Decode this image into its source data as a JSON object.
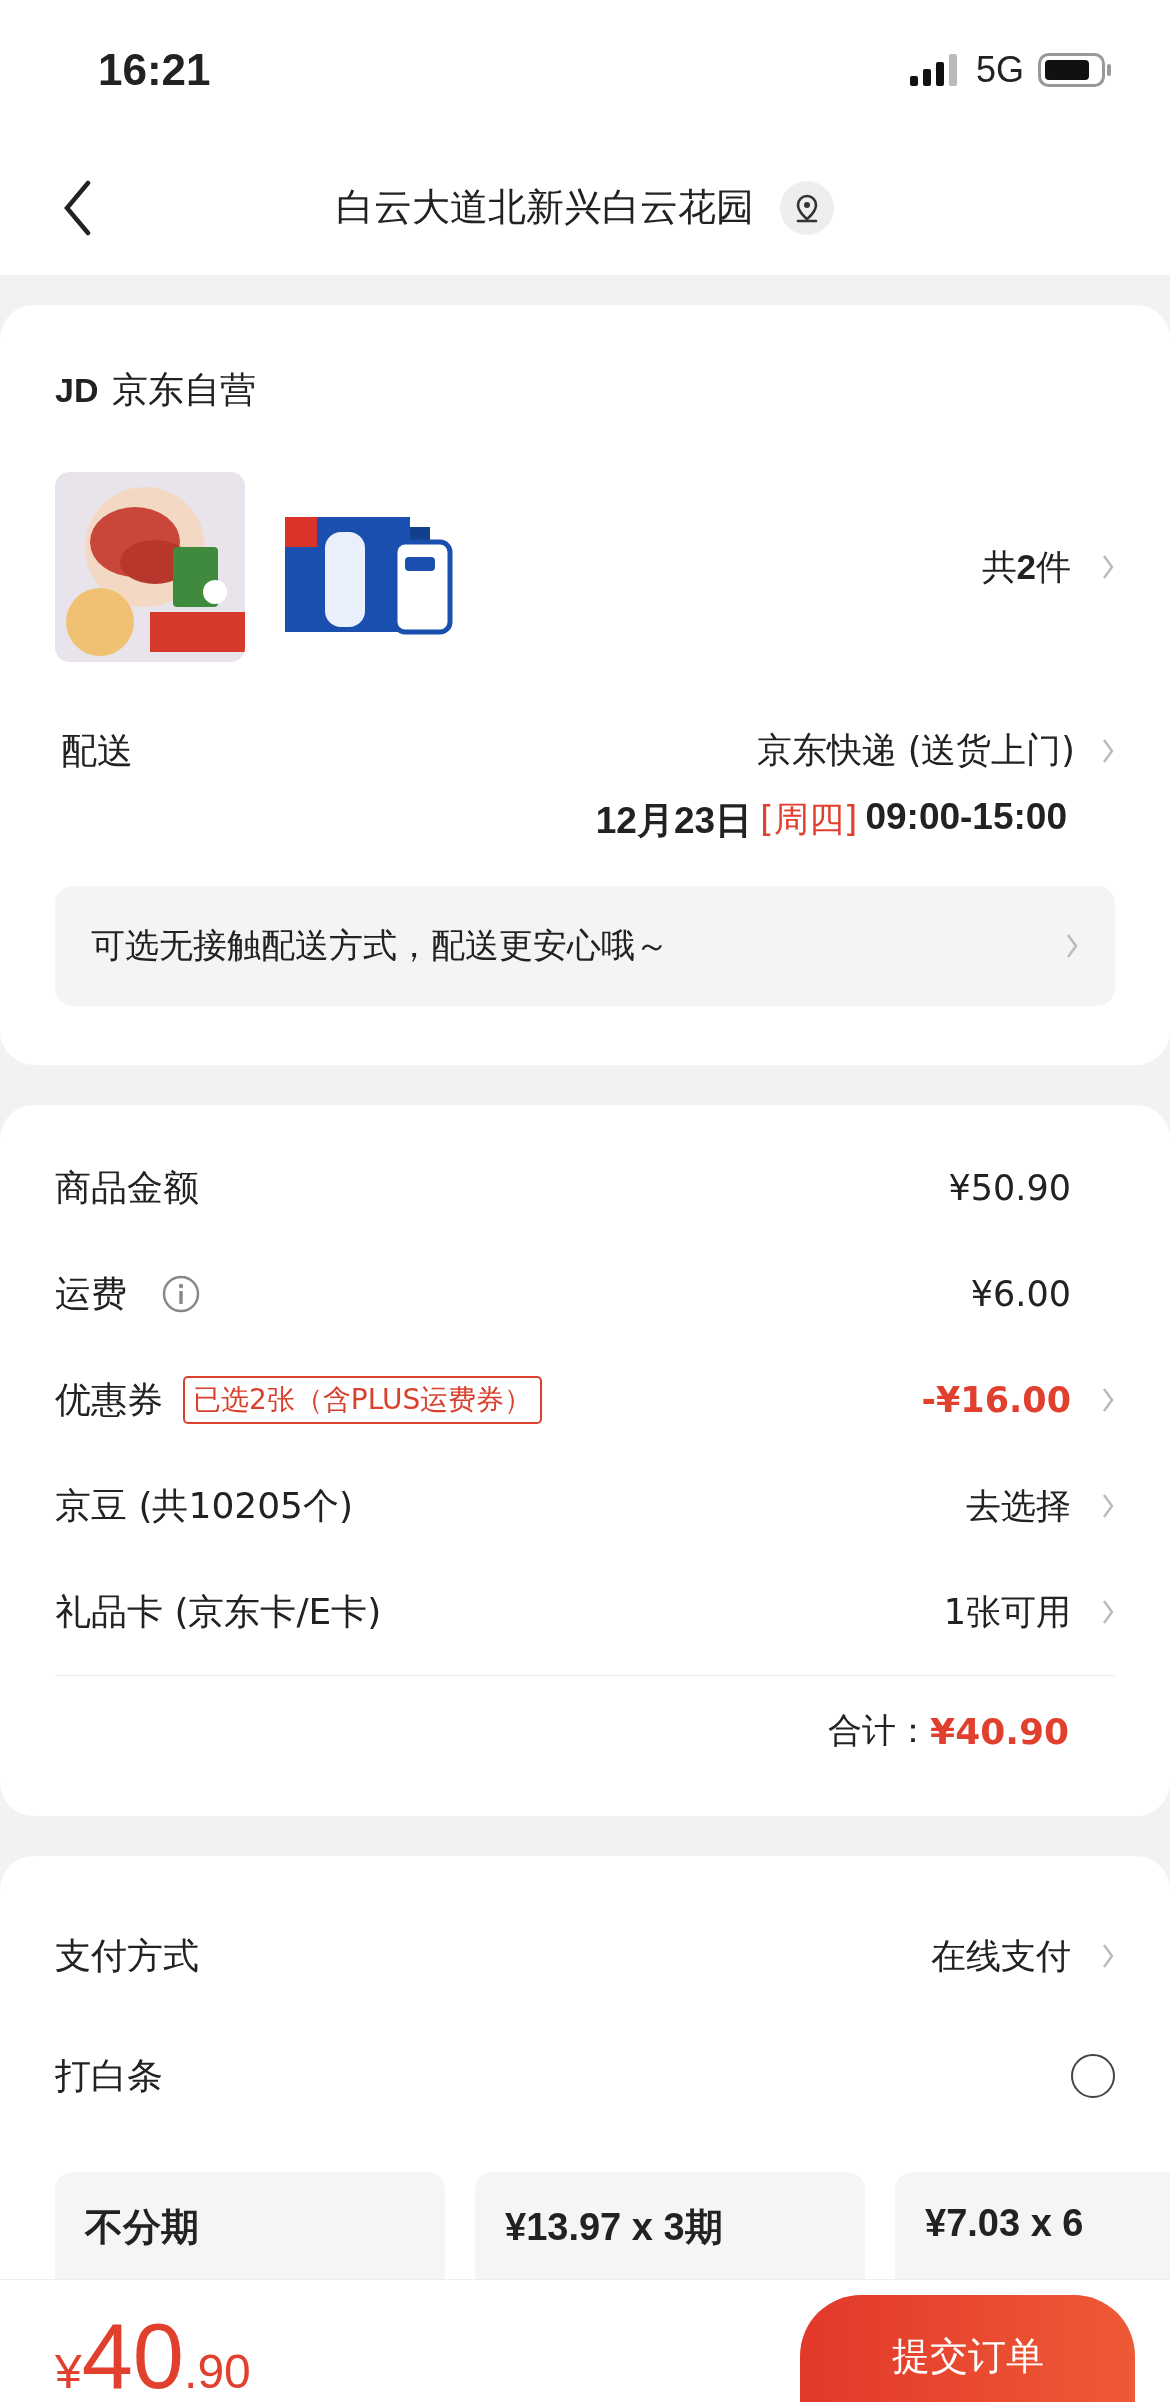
{
  "status_bar": {
    "time": "16:21",
    "network": "5G"
  },
  "header": {
    "title": "白云大道北新兴白云花园"
  },
  "store": {
    "logo": "JD",
    "name": "京东自营",
    "count_prefix": "共",
    "count": "2",
    "count_suffix": "件"
  },
  "delivery": {
    "label": "配送",
    "method": "京东快递 (送货上门)",
    "date": "12月23日",
    "weekday": "[周四]",
    "time": "09:00-15:00",
    "notice": "可选无接触配送方式，配送更安心哦～"
  },
  "price_rows": [
    {
      "label": "商品金额",
      "value": "¥50.90",
      "highlight": false,
      "chevron": false
    },
    {
      "label": "运费",
      "info": true,
      "value": "¥6.00",
      "highlight": false,
      "chevron": false
    },
    {
      "label": "优惠券",
      "tag": "已选2张（含PLUS运费券）",
      "value": "-¥16.00",
      "highlight": true,
      "chevron": true
    },
    {
      "label": "京豆 (共10205个)",
      "value": "去选择",
      "highlight": false,
      "chevron": true
    },
    {
      "label": "礼品卡 (京东卡/E卡)",
      "value": "1张可用",
      "highlight": false,
      "chevron": true
    }
  ],
  "total": {
    "label": "合计：",
    "value": "¥40.90"
  },
  "payment": {
    "label": "支付方式",
    "value": "在线支付",
    "baitiao_label": "打白条",
    "baitiao_checked": false,
    "plans": [
      {
        "title": "不分期"
      },
      {
        "title": "¥13.97 x 3期"
      },
      {
        "title": "¥7.03 x 6"
      }
    ]
  },
  "bottom_bar": {
    "currency": "¥",
    "integer": "40",
    "decimal": ".90",
    "submit": "提交订单"
  }
}
